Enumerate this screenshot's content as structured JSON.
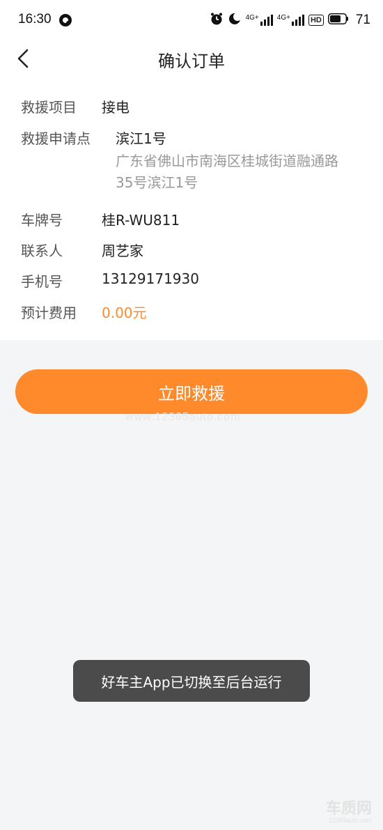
{
  "status_bar": {
    "time": "16:30",
    "signal_1": "4G+",
    "signal_2": "4G+",
    "hd": "HD",
    "battery": "71"
  },
  "header": {
    "title": "确认订单"
  },
  "order": {
    "rescue_item_label": "救援项目",
    "rescue_item_value": "接电",
    "location_label": "救援申请点",
    "location_name": "滨江1号",
    "location_address": "广东省佛山市南海区桂城街道融通路35号滨江1号",
    "plate_label": "车牌号",
    "plate_value": "桂R-WU811",
    "contact_label": "联系人",
    "contact_value": "周艺家",
    "phone_label": "手机号",
    "phone_value": "13129171930",
    "fee_label": "预计费用",
    "fee_value": "0.00元"
  },
  "actions": {
    "rescue_button": "立即救援"
  },
  "watermark": {
    "url": "www.12365auto.com",
    "logo": "车质网",
    "logo_url": "12365auto.com"
  },
  "toast": {
    "message": "好车主App已切换至后台运行"
  },
  "colors": {
    "accent": "#ff8a2c",
    "fee": "#ff8a2c",
    "toast_bg": "#4b4b4b",
    "page_bg": "#f4f5f7"
  },
  "icons": {
    "back": "chevron-left-icon",
    "alarm": "alarm-clock-icon",
    "dnd": "moon-icon",
    "battery": "battery-icon"
  }
}
